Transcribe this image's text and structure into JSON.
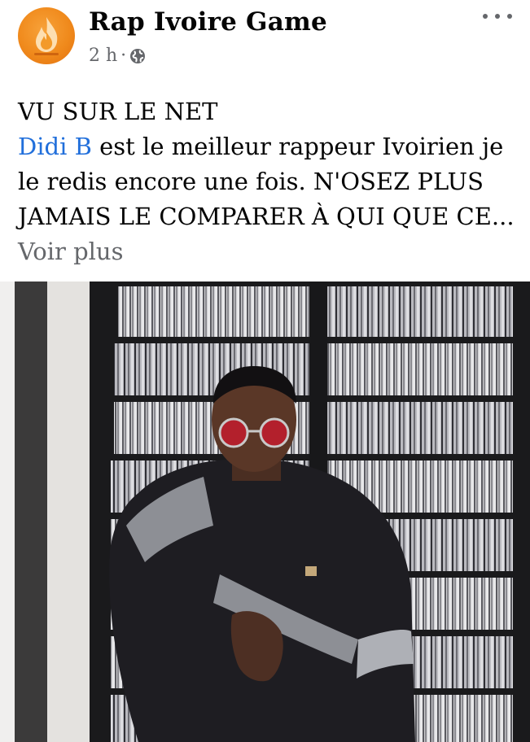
{
  "header": {
    "page_name": "Rap Ivoire Game",
    "time": "2 h",
    "separator": "·",
    "avatar_icon": "flame-logo-icon",
    "privacy_icon": "globe-icon",
    "more_icon": "more-dots-icon"
  },
  "post": {
    "line1": "VU SUR LE NET",
    "mention": "Didi B",
    "text_after_mention": " est le meilleur rappeur Ivoirien je le redis encore une fois. N'OSEZ PLUS JAMAIS LE COMPARER À QUI QUE CE...",
    "see_more": "Voir plus"
  },
  "colors": {
    "link": "#216fdb",
    "secondary_text": "#65676b",
    "avatar_orange": "#f08a1c"
  }
}
